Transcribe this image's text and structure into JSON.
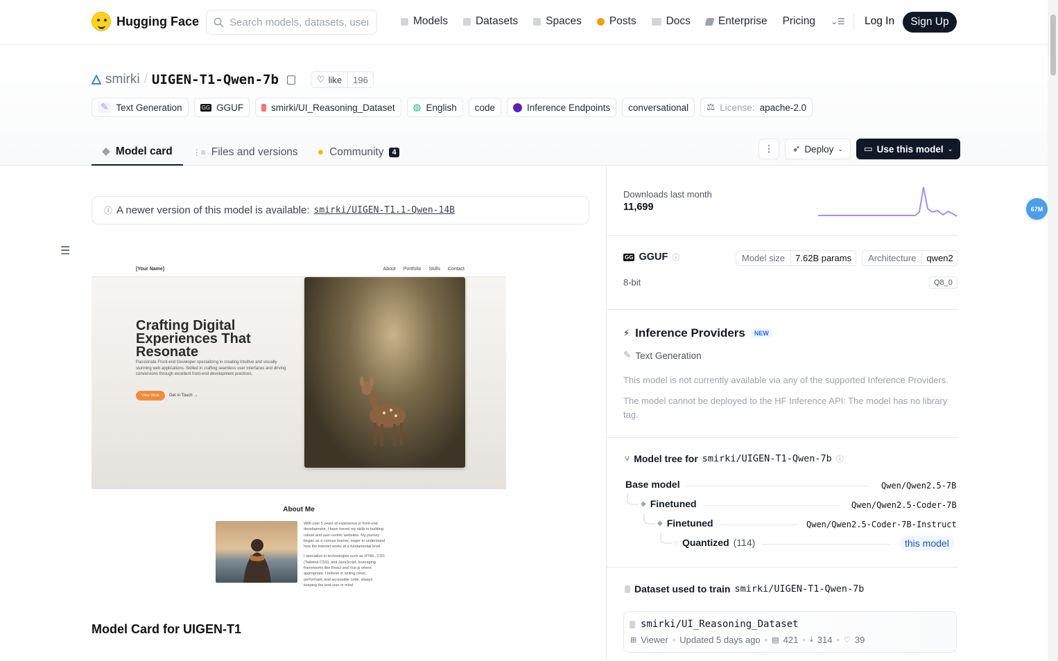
{
  "nav": {
    "brand": "Hugging Face",
    "search_placeholder": "Search models, datasets, users...",
    "links": [
      "Models",
      "Datasets",
      "Spaces",
      "Posts",
      "Docs",
      "Enterprise",
      "Pricing"
    ],
    "login": "Log In",
    "signup": "Sign Up"
  },
  "repo": {
    "owner": "smirki",
    "name": "UIGEN-T1-Qwen-7b",
    "like_label": "like",
    "like_count": "196"
  },
  "tags": {
    "text_generation": "Text Generation",
    "gguf": "GGUF",
    "dataset": "smirki/UI_Reasoning_Dataset",
    "english": "English",
    "code": "code",
    "endpoints": "Inference Endpoints",
    "conversational": "conversational",
    "license_key": "License:",
    "license_val": "apache-2.0"
  },
  "tabs": {
    "model_card": "Model card",
    "files": "Files and versions",
    "community": "Community",
    "community_count": "4"
  },
  "actions": {
    "deploy": "Deploy",
    "use_model": "Use this model"
  },
  "notice": {
    "text": "A newer version of this model is available:",
    "link": "smirki/UIGEN-T1.1-Qwen-14B"
  },
  "preview": {
    "name": "[Your Name]",
    "links": [
      "About",
      "Portfolio",
      "Skills",
      "Contact"
    ],
    "headline": "Crafting Digital Experiences That Resonate",
    "para": "Passionate Front-end Developer specializing in creating intuitive and visually stunning web applications. Skilled in crafting seamless user interfaces and driving conversions through excellent front-end development practices.",
    "cta": "View Work",
    "cta2": "Get in Touch →",
    "about_heading": "About Me",
    "about_p1": "With over 5 years of experience in front-end development, I have honed my skills in building robust and user-centric websites. My journey began as a curious learner, eager to understand how the internet works at a fundamental level.",
    "about_p2": "I specialize in technologies such as HTML, CSS (Tailwind CSS), and JavaScript, leveraging frameworks like React and Vue.js where appropriate. I believe in writing clean, performant, and accessible code, always keeping the end-user in mind."
  },
  "card_title": "Model Card for UIGEN-T1",
  "sidebar": {
    "downloads_label": "Downloads last month",
    "downloads_value": "11,699",
    "gguf": "GGUF",
    "model_size_key": "Model size",
    "model_size_val": "7.62B params",
    "arch_key": "Architecture",
    "arch_val": "qwen2",
    "bit": "8-bit",
    "quant": "Q8_0",
    "ip_title": "Inference Providers",
    "ip_new": "NEW",
    "ip_task": "Text Generation",
    "ip_p1": "This model is not currently available via any of the supported Inference Providers.",
    "ip_p2": "The model cannot be deployed to the HF Inference API: The model has no library tag.",
    "tree_title": "Model tree for",
    "tree_repo": "smirki/UIGEN-T1-Qwen-7b",
    "base_label": "Base model",
    "base_val": "Qwen/Qwen2.5-7B",
    "ft1_label": "Finetuned",
    "ft1_val": "Qwen/Qwen2.5-Coder-7B",
    "ft2_label": "Finetuned",
    "ft2_val": "Qwen/Qwen2.5-Coder-7B-Instruct",
    "quant_label": "Quantized",
    "quant_count": "(114)",
    "this_model": "this model",
    "ds_title": "Dataset used to train",
    "ds_repo": "smirki/UIGEN-T1-Qwen-7b",
    "ds_name": "smirki/UI_Reasoning_Dataset",
    "ds_viewer": "Viewer",
    "ds_updated": "Updated 5 days ago",
    "ds_rows": "421",
    "ds_downloads": "314",
    "ds_likes": "39"
  },
  "float_badge": "67M",
  "colors": {
    "accent": "#111827",
    "spark": "#a78bfa",
    "link_blue": "#1d4ed8"
  }
}
